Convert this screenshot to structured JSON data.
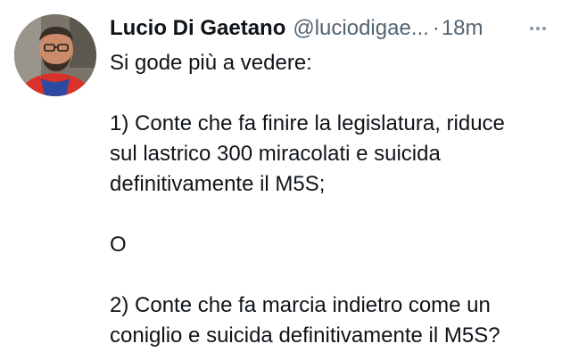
{
  "author": {
    "display_name": "Lucio Di Gaetano",
    "handle": "@luciodigae...",
    "separator": "·",
    "time": "18m"
  },
  "tweet": {
    "line_1": "Si gode più a vedere:",
    "line_2": "1) Conte che fa finire la legislatura, riduce",
    "line_3": "sul lastrico 300 miracolati e suicida",
    "line_4": "definitivamente il M5S;",
    "line_5": "O",
    "line_6": "2) Conte che fa marcia indietro come un",
    "line_7": "coniglio e suicida definitivamente il M5S?"
  },
  "icons": {
    "avatar": "profile-photo",
    "more": "more-dots-icon"
  },
  "colors": {
    "text": "#0f1419",
    "secondary": "#536471"
  }
}
